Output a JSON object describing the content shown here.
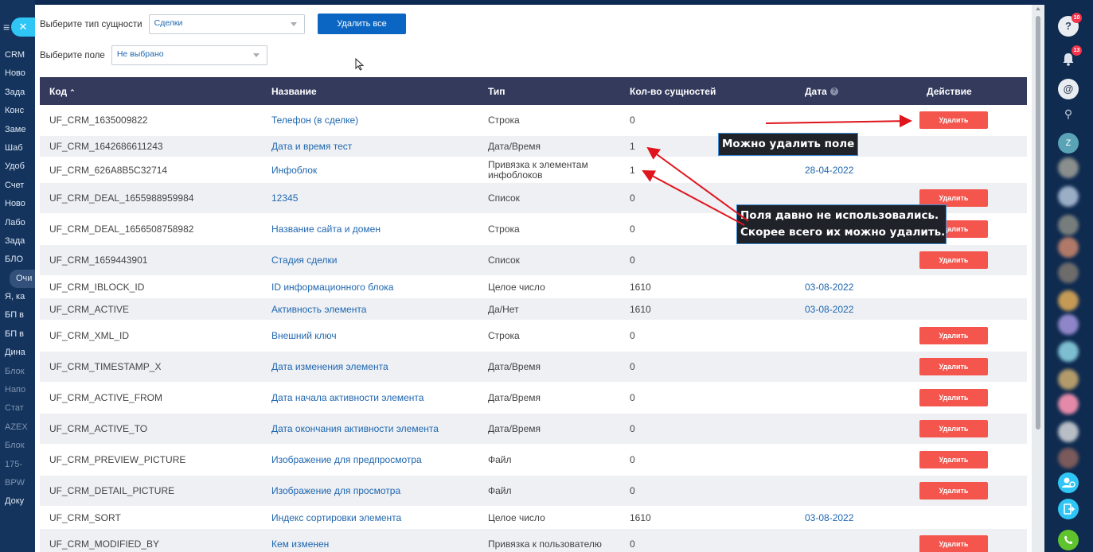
{
  "left_nav": {
    "items": [
      "CRM",
      "Ново",
      "Зада",
      "Конс",
      "Заме",
      "Шаб",
      "Удоб",
      "Счет",
      "Ново",
      "Лабо",
      "Зада",
      "БЛО",
      "Очи",
      "Я, ка",
      "БП в",
      "БП в",
      "Дина",
      "Блок",
      "Напо",
      "Стат",
      "AZEX",
      "Блок",
      "175-",
      "BPW",
      "Доку"
    ],
    "burger": "≡",
    "close": "✕"
  },
  "filters": {
    "entity_label": "Выберите тип сущности",
    "entity_value": "Сделки",
    "field_label": "Выберите поле",
    "field_value": "Не выбрано",
    "delete_all": "Удалить все"
  },
  "table": {
    "headers": {
      "code": "Код",
      "sort_arrow": "⌃",
      "name": "Название",
      "type": "Тип",
      "count": "Кол-во сущностей",
      "date": "Дата",
      "date_info": "?",
      "action": "Действие"
    },
    "delete_label": "Удалить",
    "rows": [
      {
        "code": "UF_CRM_1635009822",
        "name": "Телефон (в сделке)",
        "type": "Строка",
        "count": "0",
        "date": "",
        "can_delete": true
      },
      {
        "code": "UF_CRM_1642686611243",
        "name": "Дата и время тест",
        "type": "Дата/Время",
        "count": "1",
        "date": "",
        "can_delete": false
      },
      {
        "code": "UF_CRM_626A8B5C32714",
        "name": "Инфоблок",
        "type": "Привязка к элементам инфоблоков",
        "count": "1",
        "date": "28-04-2022",
        "can_delete": false
      },
      {
        "code": "UF_CRM_DEAL_1655988959984",
        "name": "12345",
        "type": "Список",
        "count": "0",
        "date": "",
        "can_delete": true
      },
      {
        "code": "UF_CRM_DEAL_1656508758982",
        "name": "Название сайта и домен",
        "type": "Строка",
        "count": "0",
        "date": "",
        "can_delete": true
      },
      {
        "code": "UF_CRM_1659443901",
        "name": "Стадия сделки",
        "type": "Список",
        "count": "0",
        "date": "",
        "can_delete": true
      },
      {
        "code": "UF_CRM_IBLOCK_ID",
        "name": "ID информационного блока",
        "type": "Целое число",
        "count": "1610",
        "date": "03-08-2022",
        "can_delete": false
      },
      {
        "code": "UF_CRM_ACTIVE",
        "name": "Активность элемента",
        "type": "Да/Нет",
        "count": "1610",
        "date": "03-08-2022",
        "can_delete": false
      },
      {
        "code": "UF_CRM_XML_ID",
        "name": "Внешний ключ",
        "type": "Строка",
        "count": "0",
        "date": "",
        "can_delete": true
      },
      {
        "code": "UF_CRM_TIMESTAMP_X",
        "name": "Дата изменения элемента",
        "type": "Дата/Время",
        "count": "0",
        "date": "",
        "can_delete": true
      },
      {
        "code": "UF_CRM_ACTIVE_FROM",
        "name": "Дата начала активности элемента",
        "type": "Дата/Время",
        "count": "0",
        "date": "",
        "can_delete": true
      },
      {
        "code": "UF_CRM_ACTIVE_TO",
        "name": "Дата окончания активности элемента",
        "type": "Дата/Время",
        "count": "0",
        "date": "",
        "can_delete": true
      },
      {
        "code": "UF_CRM_PREVIEW_PICTURE",
        "name": "Изображение для предпросмотра",
        "type": "Файл",
        "count": "0",
        "date": "",
        "can_delete": true
      },
      {
        "code": "UF_CRM_DETAIL_PICTURE",
        "name": "Изображение для просмотра",
        "type": "Файл",
        "count": "0",
        "date": "",
        "can_delete": true
      },
      {
        "code": "UF_CRM_SORT",
        "name": "Индекс сортировки элемента",
        "type": "Целое число",
        "count": "1610",
        "date": "03-08-2022",
        "can_delete": false
      },
      {
        "code": "UF_CRM_MODIFIED_BY",
        "name": "Кем изменен",
        "type": "Привязка к пользователю",
        "count": "0",
        "date": "",
        "can_delete": true
      }
    ]
  },
  "annotations": {
    "callout_1": "Можно удалить поле",
    "callout_2_line1": "Поля давно не использовались.",
    "callout_2_line2": "Скорее всего их можно удалить.",
    "arrow_color": "#e0141c"
  },
  "right_rail": {
    "help_icon": "?",
    "help_badge": "10",
    "bell_badge": "13",
    "chat_icon": "@",
    "search_icon": "⚲",
    "user_initial": "Z"
  },
  "colors": {
    "header_bg": "#333a5c",
    "primary": "#0b66c3",
    "danger": "#f4564e",
    "link": "#2067b0"
  }
}
